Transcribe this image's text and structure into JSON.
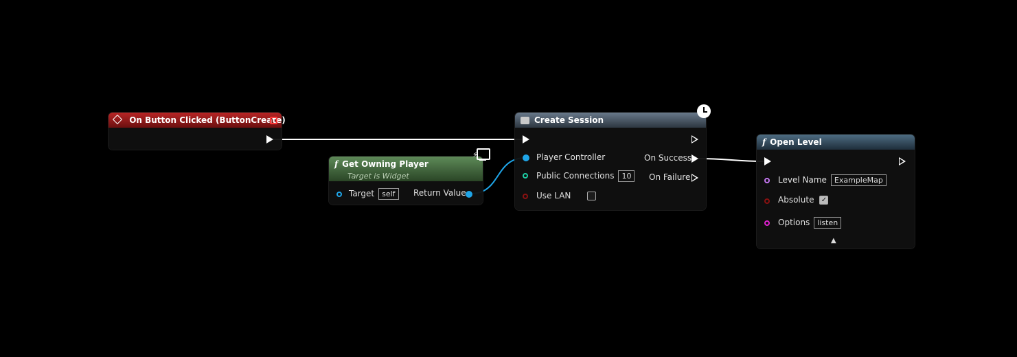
{
  "event_node": {
    "title": "On Button Clicked (ButtonCreate)",
    "color": "#b82525"
  },
  "get_owning_player": {
    "title": "Get Owning Player",
    "subtitle": "Target is Widget",
    "target_label": "Target",
    "target_value": "self",
    "return_label": "Return Value"
  },
  "create_session": {
    "title": "Create Session",
    "player_controller": "Player Controller",
    "public_connections": "Public Connections",
    "public_connections_value": "10",
    "use_lan": "Use LAN",
    "on_success": "On Success",
    "on_failure": "On Failure"
  },
  "open_level": {
    "title": "Open Level",
    "level_name_label": "Level Name",
    "level_name_value": "ExampleMap",
    "absolute_label": "Absolute",
    "options_label": "Options",
    "options_value": "listen",
    "expand_arrow": "▲"
  },
  "icons": {
    "event": "event-diamond-icon",
    "function": "function-f-icon",
    "macro": "macro-icon",
    "latent": "clock-icon",
    "client_only": "monitor-icon"
  }
}
